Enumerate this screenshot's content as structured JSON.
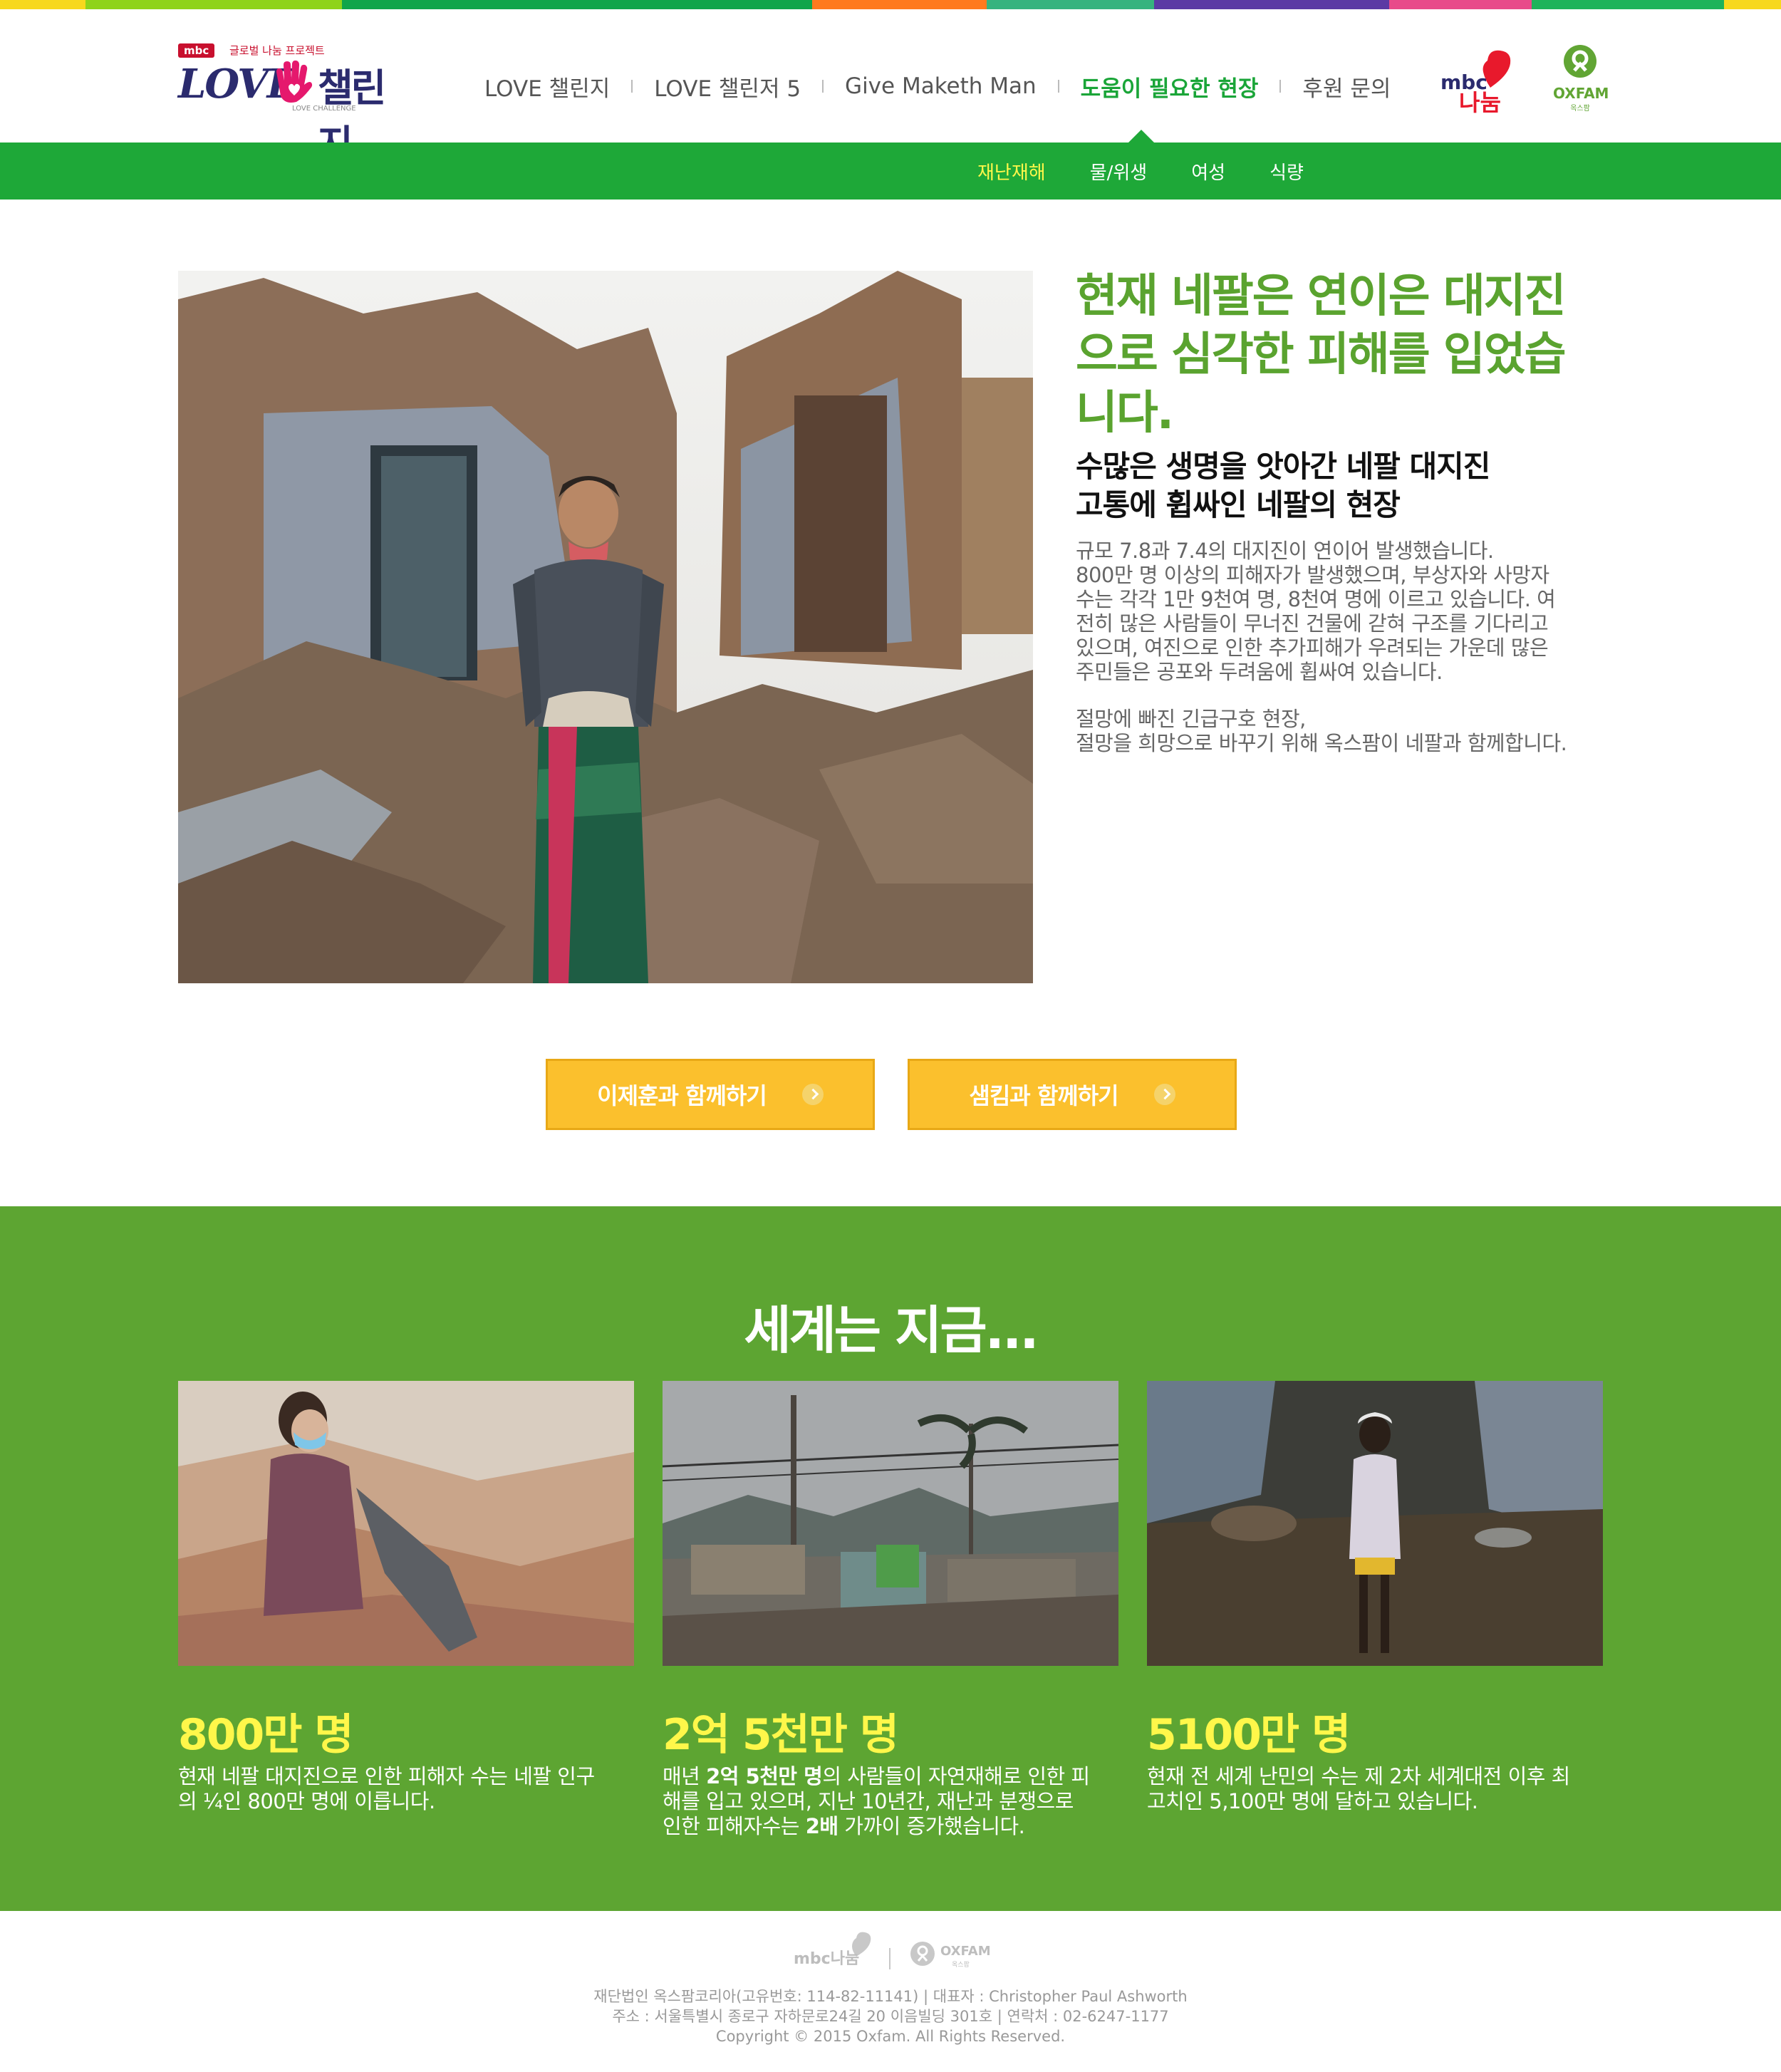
{
  "colors": {
    "stripe": [
      "#f7d81d",
      "#8fd31a",
      "#10a54a",
      "#ff7a1e",
      "#36b37e",
      "#5b3aa4",
      "#e84a8a",
      "#1eb35a",
      "#f7d81d"
    ],
    "brand_green": "#1ea838",
    "section_green": "#5da532",
    "headline_green": "#5aa32f",
    "highlight_yellow": "#fff74a",
    "button_yellow": "#fbc02d"
  },
  "header": {
    "logo": {
      "mbc": "mbc",
      "mbc_sub": "글로벌 나눔 프로젝트",
      "love": "LOVE",
      "challenge": "챌린지",
      "challenge_sub": "LOVE CHALLENGE"
    },
    "nav": [
      {
        "label": "LOVE 챌린지",
        "active": false
      },
      {
        "label": "LOVE 챌린저 5",
        "active": false
      },
      {
        "label": "Give Maketh Man",
        "active": false
      },
      {
        "label": "도움이 필요한 현장",
        "active": true
      },
      {
        "label": "후원 문의",
        "active": false
      }
    ],
    "partner_mbc": {
      "top": "mbc",
      "bottom": "나눔"
    },
    "partner_oxfam": {
      "label": "OXFAM",
      "sub": "옥스팜"
    }
  },
  "subnav": [
    {
      "label": "재난재해",
      "active": true
    },
    {
      "label": "물/위생",
      "active": false
    },
    {
      "label": "여성",
      "active": false
    },
    {
      "label": "식량",
      "active": false
    }
  ],
  "feature": {
    "headline": "현재 네팔은 연이은 대지진으로 심각한 피해를 입었습니다.",
    "subhead_line1": "수많은 생명을 앗아간 네팔 대지진",
    "subhead_line2": "고통에 휩싸인 네팔의 현장",
    "para_lines": [
      "규모 7.8과 7.4의 대지진이 연이어 발생했습니다.",
      "800만 명 이상의 피해자가 발생했으며, 부상자와 사망자",
      "수는 각각 1만 9천여 명, 8천여 명에 이르고 있습니다. 여",
      "전히 많은 사람들이 무너진 건물에 갇혀 구조를 기다리고",
      "있으며, 여진으로 인한 추가피해가 우려되는 가운데 많은",
      "주민들은 공포와 두려움에 휩싸여 있습니다."
    ],
    "para2_lines": [
      "절망에 빠진 긴급구호 현장,",
      "절망을 희망으로 바꾸기 위해 옥스팜이 네팔과 함께합니다."
    ]
  },
  "buttons": [
    {
      "label": "이제훈과 함께하기"
    },
    {
      "label": "샘킴과 함께하기"
    }
  ],
  "world": {
    "title": "세계는 지금...",
    "cards": [
      {
        "number": "800만 명",
        "lines": [
          "현재 네팔 대지진으로 인한 피해자 수는 네팔 인구",
          "의 ¼인 800만 명에 이릅니다."
        ]
      },
      {
        "number": "2억 5천만 명",
        "l1a": "매년 ",
        "l1b": "2억 5천만 명",
        "l1c": "의 사람들이 자연재해로 인한 피",
        "l2": "해를 입고 있으며, 지난 10년간, 재난과 분쟁으로",
        "l3a": "인한 피해자수는 ",
        "l3b": "2배",
        "l3c": " 가까이 증가했습니다."
      },
      {
        "number": "5100만 명",
        "lines": [
          "현재 전 세계 난민의 수는 제 2차 세계대전 이후 최",
          "고치인 5,100만 명에 달하고 있습니다."
        ]
      }
    ]
  },
  "footer": {
    "logo_mbc": "mbc나눔",
    "logo_oxfam": "OXFAM",
    "logo_oxfam_sub": "옥스팜",
    "line1": "재단법인 옥스팜코리아(고유번호: 114-82-11141) | 대표자 : Christopher Paul Ashworth",
    "line2": "주소 : 서울특별시 종로구 자하문로24길 20 이음빌딩 301호 | 연락처 : 02-6247-1177",
    "line3": "Copyright © 2015 Oxfam. All Rights Reserved."
  }
}
